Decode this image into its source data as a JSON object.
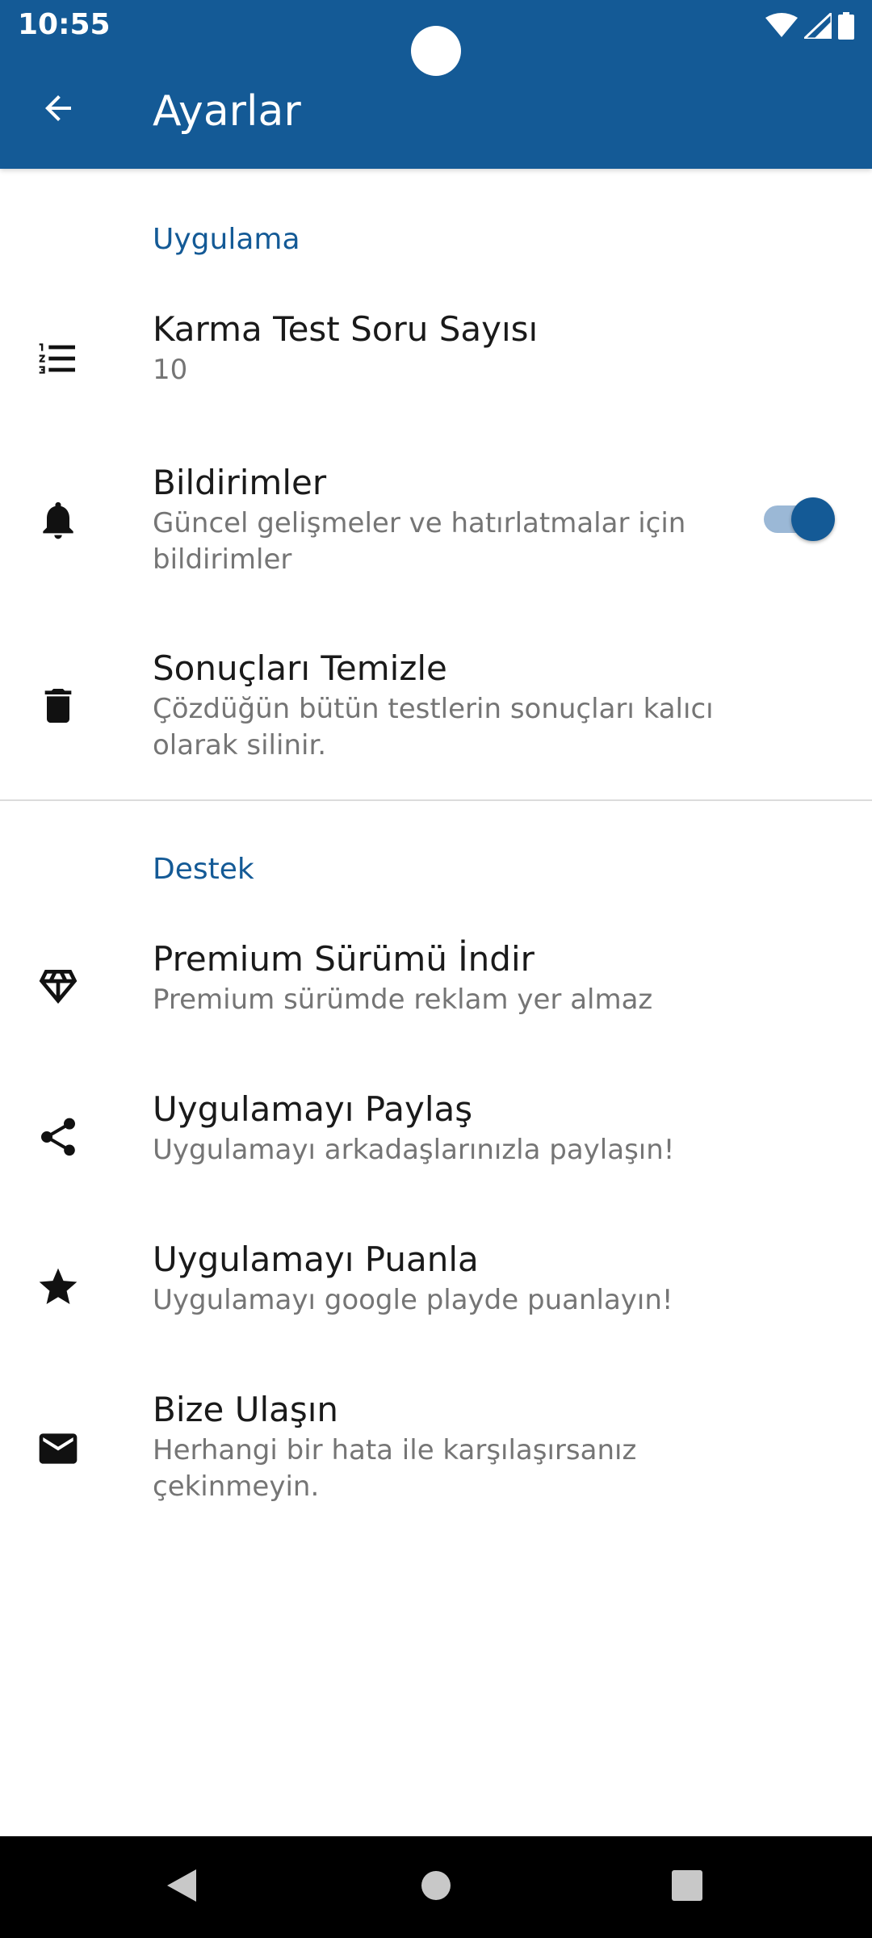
{
  "status_bar": {
    "time": "10:55"
  },
  "app_bar": {
    "title": "Ayarlar",
    "back_icon": "arrow-back-icon",
    "color": "#145a96"
  },
  "sections": {
    "app": {
      "header": "Uygulama",
      "items": [
        {
          "icon": "format-list-numbered-icon",
          "title": "Karma Test Soru Sayısı",
          "summary": "10"
        },
        {
          "icon": "bell-icon",
          "title": "Bildirimler",
          "summary": "Güncel gelişmeler ve hatırlatmalar için bildirimler",
          "toggle_on": true
        },
        {
          "icon": "trash-icon",
          "title": "Sonuçları Temizle",
          "summary": "Çözdüğün bütün testlerin sonuçları kalıcı olarak silinir."
        }
      ]
    },
    "support": {
      "header": "Destek",
      "items": [
        {
          "icon": "diamond-icon",
          "title": "Premium Sürümü İndir",
          "summary": "Premium sürümde reklam yer almaz"
        },
        {
          "icon": "share-icon",
          "title": "Uygulamayı Paylaş",
          "summary": "Uygulamayı arkadaşlarınızla paylaşın!"
        },
        {
          "icon": "star-icon",
          "title": "Uygulamayı Puanla",
          "summary": "Uygulamayı google playde puanlayın!"
        },
        {
          "icon": "mail-icon",
          "title": "Bize Ulaşın",
          "summary": "Herhangi bir hata ile karşılaşırsanız çekinmeyin."
        }
      ]
    }
  },
  "nav_bar": {
    "buttons": [
      "back-triangle-icon",
      "home-circle-icon",
      "recents-square-icon"
    ]
  }
}
